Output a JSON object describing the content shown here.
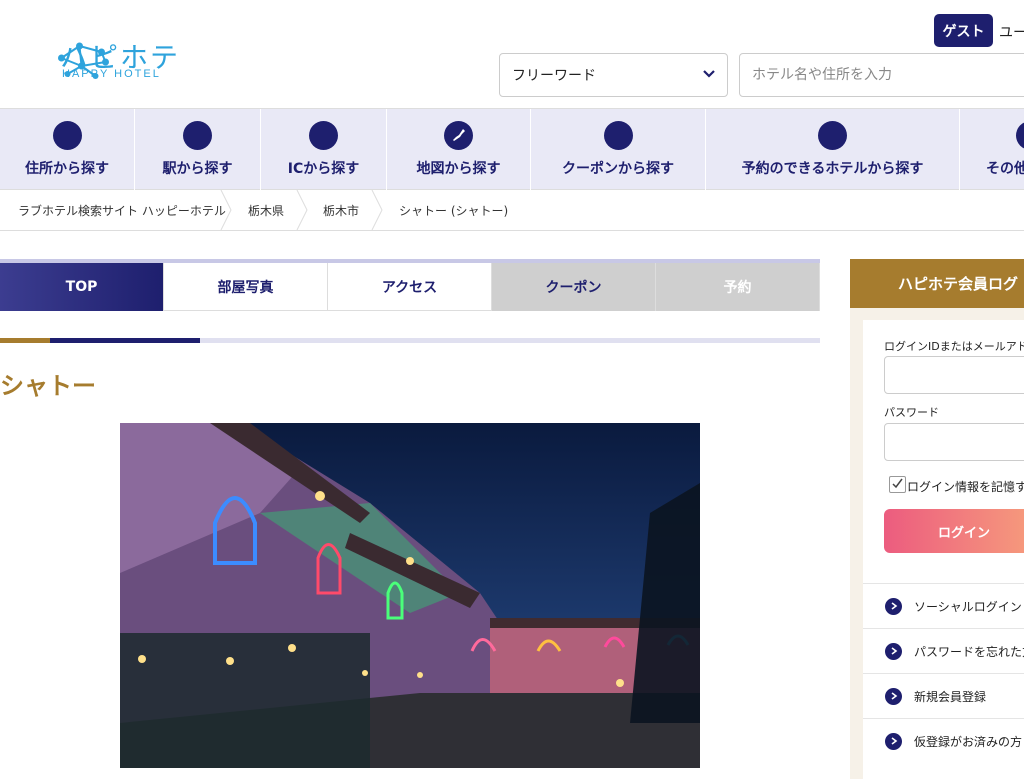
{
  "header": {
    "logo_kana": "ハピホテ",
    "logo_en": "HAPPY HOTEL",
    "guest_label": "ゲスト",
    "user_label": "ユー",
    "search_select_value": "フリーワード",
    "search_placeholder": "ホテル名や住所を入力"
  },
  "nav": {
    "items": [
      {
        "label": "住所から探す"
      },
      {
        "label": "駅から探す"
      },
      {
        "label": "ICから探す"
      },
      {
        "label": "地図から探す"
      },
      {
        "label": "クーポンから探す"
      },
      {
        "label": "予約のできるホテルから探す"
      },
      {
        "label": "その他"
      }
    ]
  },
  "breadcrumb": [
    "ラブホテル検索サイト ハッピーホテル",
    "栃木県",
    "栃木市",
    "シャトー (シャトー)"
  ],
  "tabs": {
    "top": "TOP",
    "photo": "部屋写真",
    "access": "アクセス",
    "coupon": "クーポン",
    "reserve": "予約"
  },
  "hotel": {
    "name": "シャトー"
  },
  "sidebar": {
    "title": "ハピホテ会員ログ",
    "login_id_label": "ログインIDまたはメールアド",
    "password_label": "パスワード",
    "remember_label": "ログイン情報を記憶す",
    "login_button": "ログイン",
    "links": [
      "ソーシャルログイン",
      "パスワードを忘れた方",
      "新規会員登録",
      "仮登録がお済みの方"
    ]
  },
  "colors": {
    "navy": "#1e1f6e",
    "gold": "#a67c2e",
    "logo_blue": "#2ea3dc",
    "login_pink": "#ec5c7f"
  }
}
